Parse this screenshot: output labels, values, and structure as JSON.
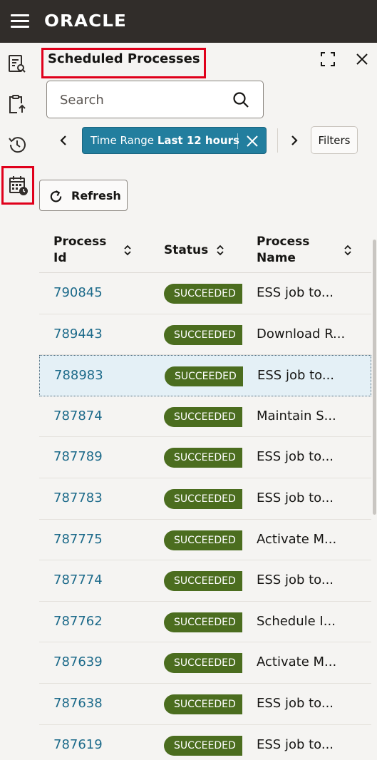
{
  "app": {
    "brand": "ORACLE"
  },
  "rail": {
    "items": [
      {
        "icon": "report-search-icon"
      },
      {
        "icon": "clipboard-upload-icon"
      },
      {
        "icon": "history-icon"
      },
      {
        "icon": "calendar-schedule-icon",
        "active": true
      }
    ]
  },
  "panel": {
    "title": "Scheduled Processes",
    "maximize_icon": "maximize-icon",
    "close_icon": "close-icon"
  },
  "search": {
    "placeholder": "Search",
    "value": ""
  },
  "filter_chip": {
    "label": "Time Range",
    "value": "Last 12 hours"
  },
  "filters_button": {
    "label": "Filters"
  },
  "refresh_button": {
    "label": "Refresh"
  },
  "table": {
    "columns": [
      {
        "label": "Process Id"
      },
      {
        "label": "Status"
      },
      {
        "label": "Process Name"
      }
    ],
    "rows": [
      {
        "id": "790845",
        "status": "SUCCEEDED",
        "name": "ESS job to..."
      },
      {
        "id": "789443",
        "status": "SUCCEEDED",
        "name": "Download R..."
      },
      {
        "id": "788983",
        "status": "SUCCEEDED",
        "name": "ESS job to...",
        "selected": true
      },
      {
        "id": "787874",
        "status": "SUCCEEDED",
        "name": "Maintain S..."
      },
      {
        "id": "787789",
        "status": "SUCCEEDED",
        "name": "ESS job to..."
      },
      {
        "id": "787783",
        "status": "SUCCEEDED",
        "name": "ESS job to..."
      },
      {
        "id": "787775",
        "status": "SUCCEEDED",
        "name": "Activate M..."
      },
      {
        "id": "787774",
        "status": "SUCCEEDED",
        "name": "ESS job to..."
      },
      {
        "id": "787762",
        "status": "SUCCEEDED",
        "name": "Schedule I..."
      },
      {
        "id": "787639",
        "status": "SUCCEEDED",
        "name": "Activate M..."
      },
      {
        "id": "787638",
        "status": "SUCCEEDED",
        "name": "ESS job to..."
      },
      {
        "id": "787619",
        "status": "SUCCEEDED",
        "name": "ESS job to..."
      }
    ]
  },
  "colors": {
    "topbar": "#312d2a",
    "accent": "#227e9e",
    "link": "#1c6a8a",
    "success": "#4b6d1f",
    "highlight_border": "#e0001b"
  }
}
